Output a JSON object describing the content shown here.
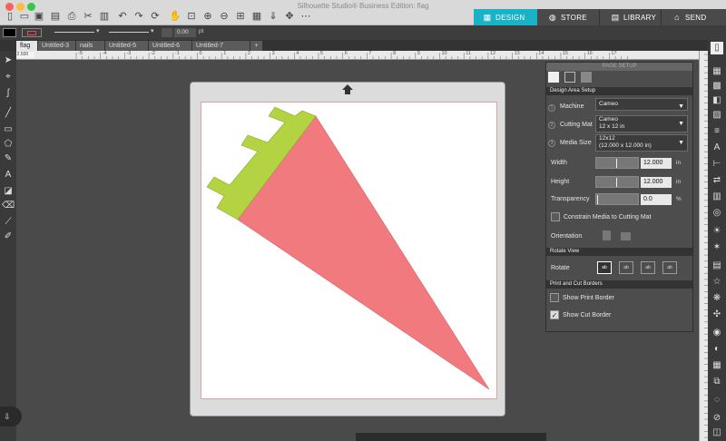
{
  "window": {
    "title": "Silhouette Studio® Business Edition: flag"
  },
  "nav_tabs": [
    {
      "label": "DESIGN",
      "icon": "grid-icon",
      "active": true
    },
    {
      "label": "STORE",
      "icon": "globe-icon",
      "active": false
    },
    {
      "label": "LIBRARY",
      "icon": "library-icon",
      "active": false
    },
    {
      "label": "SEND",
      "icon": "send-icon",
      "active": false
    }
  ],
  "options_bar": {
    "line_width": "0.00",
    "line_unit": "pt"
  },
  "doc_tabs": [
    "flag",
    "Untitled-3",
    "nails",
    "Untitled-5",
    "Untitled-6",
    "Untitled-7",
    "+"
  ],
  "coordinates": "4.750 , 2.500",
  "ruler_top": [
    "-5",
    "-4",
    "-3",
    "-2",
    "-1",
    "0",
    "1",
    "2",
    "3",
    "4",
    "5",
    "6",
    "7",
    "8",
    "9",
    "10",
    "11",
    "12",
    "13",
    "14",
    "15",
    "16",
    "17"
  ],
  "panel": {
    "header": "PAGE SETUP",
    "section_design": "Design Area Setup",
    "machine_label": "Machine",
    "machine_value": "Cameo",
    "cutting_mat_label": "Cutting Mat",
    "cutting_mat_value": "Cameo",
    "cutting_mat_sub": "12 x 12 in",
    "media_size_label": "Media Size",
    "media_size_value": "12x12",
    "media_size_sub": "(12.000 x 12.000 in)",
    "width_label": "Width",
    "width_value": "12.000",
    "width_unit": "in",
    "height_label": "Height",
    "height_value": "12.000",
    "height_unit": "in",
    "transparency_label": "Transparency",
    "transparency_value": "0.0",
    "transparency_unit": "%",
    "constrain_label": "Constrain Media to Cutting Mat",
    "orientation_label": "Orientation",
    "section_rotate": "Rotate View",
    "rotate_label": "Rotate",
    "rotate_options": [
      "ab",
      "ab",
      "ab",
      "ab"
    ],
    "section_borders": "Print and Cut Borders",
    "show_print_border_label": "Show Print Border",
    "show_print_border_checked": false,
    "show_cut_border_label": "Show Cut Border",
    "show_cut_border_checked": true
  },
  "colors": {
    "accent": "#1ab3c6",
    "flag_red": "#f07a7e",
    "flag_green": "#b3d342",
    "titlebar": "#d9d9d9",
    "workspace": "#4a4a4a"
  }
}
